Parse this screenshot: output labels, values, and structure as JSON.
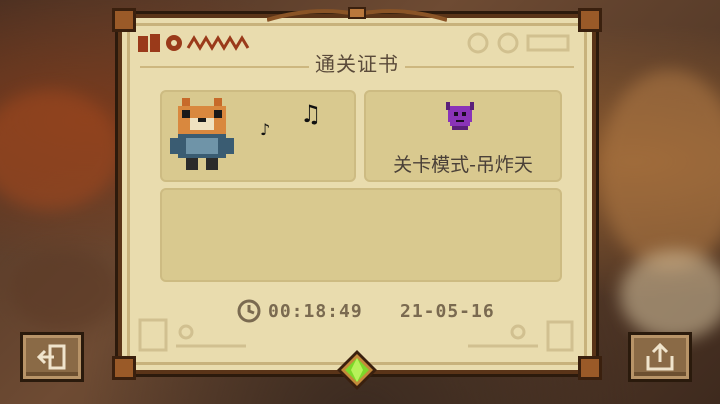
{
  "certificate": {
    "title": "通关证书",
    "mode_label": "关卡模式-吊炸天",
    "time": "00:18:49",
    "date": "21-05-16"
  },
  "icons": {
    "exit": "exit-icon",
    "share": "share-icon",
    "clock": "clock-icon",
    "mode": "demon-mask-icon",
    "gem": "green-gem-icon",
    "notes": "music-note-icon"
  },
  "colors": {
    "parchment": "#e9dcae",
    "panel": "#d9c98f",
    "frame": "#5a3418",
    "gem": "#7cd82a"
  }
}
